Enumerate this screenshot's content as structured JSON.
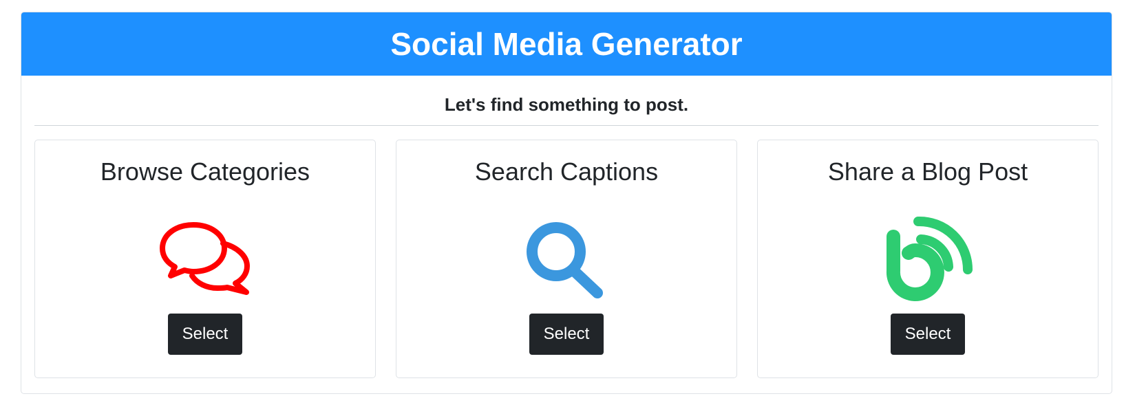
{
  "header": {
    "title": "Social Media Generator"
  },
  "subtitle": "Let's find something to post.",
  "cards": [
    {
      "title": "Browse Categories",
      "icon": "chat-bubbles-icon",
      "button_label": "Select",
      "icon_color": "#ff0000"
    },
    {
      "title": "Search Captions",
      "icon": "search-icon",
      "button_label": "Select",
      "icon_color": "#3b97de"
    },
    {
      "title": "Share a Blog Post",
      "icon": "blog-feed-icon",
      "button_label": "Select",
      "icon_color": "#2ecc71"
    }
  ],
  "colors": {
    "header_bg": "#1e90ff",
    "button_bg": "#212529"
  }
}
